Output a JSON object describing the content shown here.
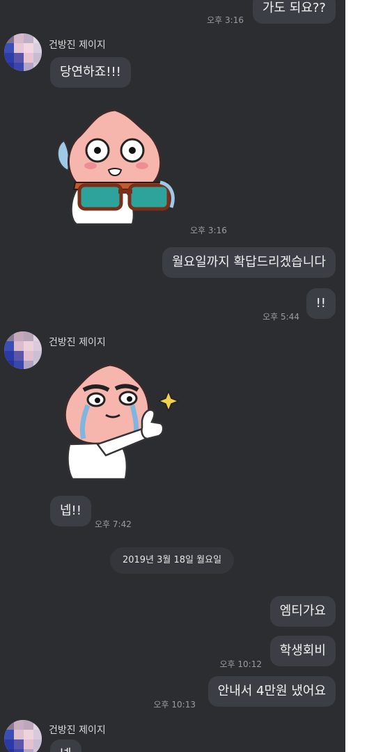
{
  "sender_name": "건방진 제이지",
  "messages": {
    "m1": {
      "text": "가도 되요??",
      "time": "오후 3:16"
    },
    "m2": {
      "text": "당연하죠!!!"
    },
    "sticker1_time": "오후 3:16",
    "m3": {
      "text": "월요일까지 확답드리겠습니다"
    },
    "m4": {
      "text": "!!",
      "time": "오후 5:44"
    },
    "m5": {
      "text": "넵!!",
      "time": "오후 7:42"
    },
    "date_divider": "2019년 3월 18일 월요일",
    "m6": {
      "text": "엠티가요"
    },
    "m7": {
      "text": "학생회비",
      "time": "오후 10:12"
    },
    "m8": {
      "text": "안내서 4만원 냈어요",
      "time": "오후 10:13"
    },
    "m9": {
      "text": "넵"
    }
  },
  "colors": {
    "background": "#2b2d31",
    "bubble": "#3b3e44",
    "text": "#f2f2f2",
    "time": "#9a9ca3"
  }
}
